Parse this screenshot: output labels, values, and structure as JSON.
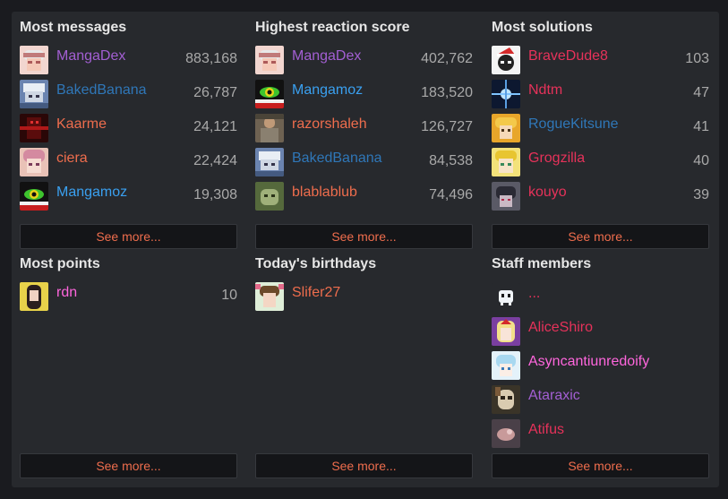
{
  "most_messages": {
    "title": "Most messages",
    "see_more": "See more...",
    "rows": [
      {
        "name": "MangaDex",
        "value": "883,168",
        "color": "#a35fd3",
        "avatar": "mangadex-avatar"
      },
      {
        "name": "BakedBanana",
        "value": "26,787",
        "color": "#2f77b8",
        "avatar": "bakedbanana-avatar"
      },
      {
        "name": "Kaarme",
        "value": "24,121",
        "color": "#ee6d4d",
        "avatar": "kaarme-avatar"
      },
      {
        "name": "ciera",
        "value": "22,424",
        "color": "#ee6d4d",
        "avatar": "ciera-avatar"
      },
      {
        "name": "Mangamoz",
        "value": "19,308",
        "color": "#3aa0f0",
        "avatar": "mangamoz-avatar"
      }
    ]
  },
  "highest_reaction_score": {
    "title": "Highest reaction score",
    "see_more": "See more...",
    "rows": [
      {
        "name": "MangaDex",
        "value": "402,762",
        "color": "#a35fd3",
        "avatar": "mangadex-avatar"
      },
      {
        "name": "Mangamoz",
        "value": "183,520",
        "color": "#3aa0f0",
        "avatar": "mangamoz-avatar"
      },
      {
        "name": "razorshaleh",
        "value": "126,727",
        "color": "#ee6d4d",
        "avatar": "razorshaleh-avatar"
      },
      {
        "name": "BakedBanana",
        "value": "84,538",
        "color": "#2f77b8",
        "avatar": "bakedbanana-avatar"
      },
      {
        "name": "blablablub",
        "value": "74,496",
        "color": "#ee6d4d",
        "avatar": "blablablub-avatar"
      }
    ]
  },
  "most_solutions": {
    "title": "Most solutions",
    "see_more": "See more...",
    "rows": [
      {
        "name": "BraveDude8",
        "value": "103",
        "color": "#e6325a",
        "avatar": "bravedude8-avatar"
      },
      {
        "name": "Ndtm",
        "value": "47",
        "color": "#e6325a",
        "avatar": "ndtm-avatar"
      },
      {
        "name": "RogueKitsune",
        "value": "41",
        "color": "#2f77b8",
        "avatar": "roguekitsune-avatar"
      },
      {
        "name": "Grogzilla",
        "value": "40",
        "color": "#e6325a",
        "avatar": "grogzilla-avatar"
      },
      {
        "name": "kouyo",
        "value": "39",
        "color": "#e6325a",
        "avatar": "kouyo-avatar"
      }
    ]
  },
  "most_points": {
    "title": "Most points",
    "see_more": "See more...",
    "rows": [
      {
        "name": "rdn",
        "value": "10",
        "color": "#ff66dd",
        "avatar": "rdn-avatar"
      }
    ]
  },
  "todays_birthdays": {
    "title": "Today's birthdays",
    "see_more": "See more...",
    "rows": [
      {
        "name": "Slifer27",
        "color": "#ee6d4d",
        "avatar": "slifer27-avatar"
      }
    ]
  },
  "staff_members": {
    "title": "Staff members",
    "see_more": "See more...",
    "rows": [
      {
        "name": "...",
        "color": "#e6325a",
        "avatar": "robot-avatar"
      },
      {
        "name": "AliceShiro",
        "color": "#e6325a",
        "avatar": "aliceshiro-avatar"
      },
      {
        "name": "Asyncantiunredoify",
        "color": "#ff66dd",
        "avatar": "asyncantiunredoify-avatar"
      },
      {
        "name": "Ataraxic",
        "color": "#a35fd3",
        "avatar": "ataraxic-avatar"
      },
      {
        "name": "Atifus",
        "color": "#e6325a",
        "avatar": "atifus-avatar"
      }
    ]
  }
}
